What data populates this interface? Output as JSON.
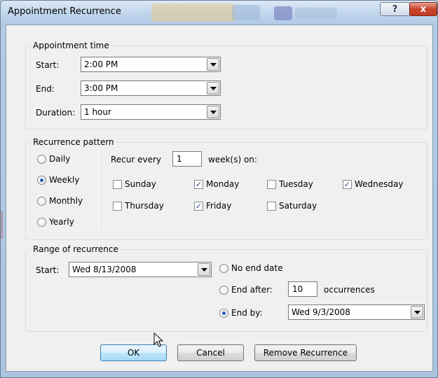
{
  "window": {
    "title": "Appointment Recurrence",
    "help_glyph": "?",
    "close_glyph": "x"
  },
  "appointment_time": {
    "legend": "Appointment time",
    "start_label": "Start:",
    "start_value": "2:00 PM",
    "end_label": "End:",
    "end_value": "3:00 PM",
    "duration_label": "Duration:",
    "duration_value": "1 hour"
  },
  "recurrence_pattern": {
    "legend": "Recurrence pattern",
    "frequency_options": [
      {
        "label": "Daily",
        "selected": false
      },
      {
        "label": "Weekly",
        "selected": true
      },
      {
        "label": "Monthly",
        "selected": false
      },
      {
        "label": "Yearly",
        "selected": false
      }
    ],
    "recur_every_label": "Recur every",
    "recur_every_value": "1",
    "weeks_on_label": "week(s) on:",
    "days": [
      {
        "label": "Sunday",
        "checked": false
      },
      {
        "label": "Monday",
        "checked": true
      },
      {
        "label": "Tuesday",
        "checked": false
      },
      {
        "label": "Wednesday",
        "checked": true
      },
      {
        "label": "Thursday",
        "checked": false
      },
      {
        "label": "Friday",
        "checked": true
      },
      {
        "label": "Saturday",
        "checked": false
      }
    ],
    "check_glyph": "✓"
  },
  "range": {
    "legend": "Range of recurrence",
    "start_label": "Start:",
    "start_value": "Wed 8/13/2008",
    "no_end_label": "No end date",
    "no_end_selected": false,
    "end_after_label": "End after:",
    "end_after_selected": false,
    "end_after_value": "10",
    "occurrences_label": "occurrences",
    "end_by_label": "End by:",
    "end_by_selected": true,
    "end_by_value": "Wed 9/3/2008"
  },
  "buttons": {
    "ok": "OK",
    "cancel": "Cancel",
    "remove": "Remove Recurrence"
  },
  "colors": {
    "radio_selected": "#1f5fbd",
    "close_button": "#c7462d",
    "default_button_border": "#3c7fb1"
  }
}
